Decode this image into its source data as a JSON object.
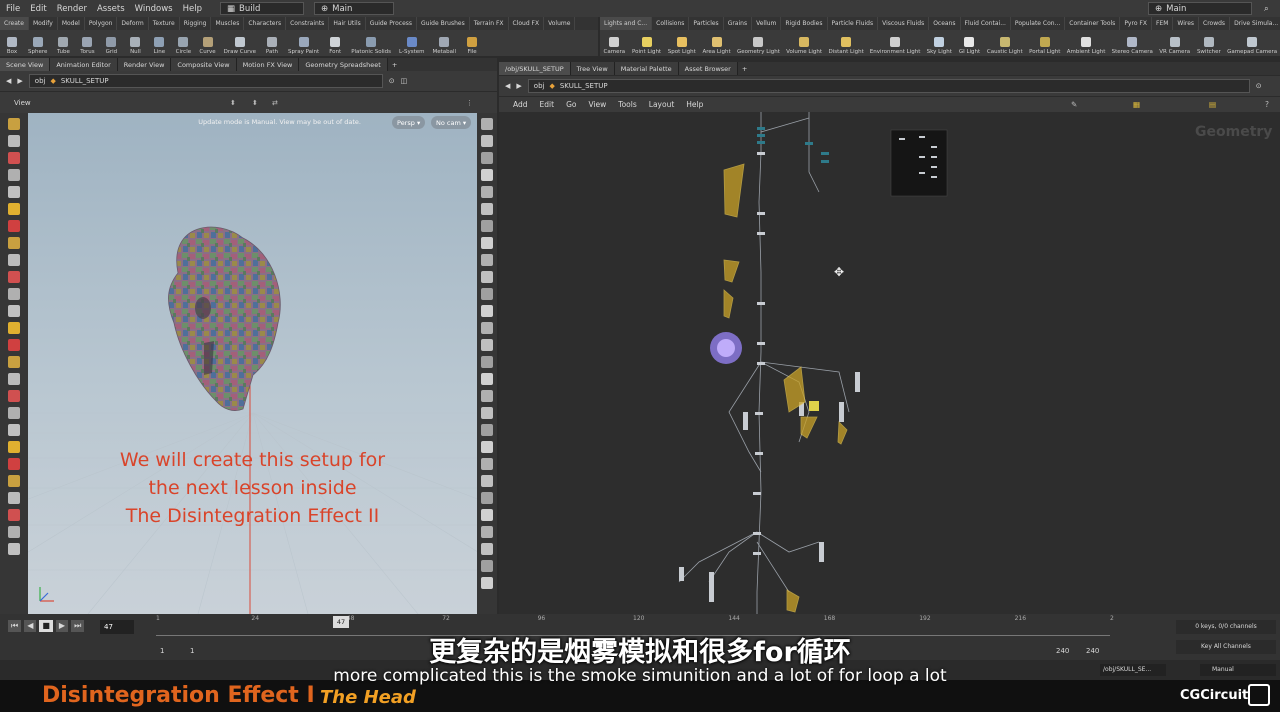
{
  "menu": [
    "File",
    "Edit",
    "Render",
    "Assets",
    "Windows",
    "Help"
  ],
  "desktop": "Build",
  "context": "Main",
  "context_right": "Main",
  "shelf_tabs_left": [
    "Create",
    "Modify",
    "Model",
    "Polygon",
    "Deform",
    "Texture",
    "Rigging",
    "Muscles",
    "Characters",
    "Constraints",
    "Hair Utils",
    "Guide Process",
    "Guide Brushes",
    "Terrain FX",
    "Cloud FX",
    "Volume"
  ],
  "shelf_tabs_right": [
    "Lights and C...",
    "Collisions",
    "Particles",
    "Grains",
    "Vellum",
    "Rigid Bodies",
    "Particle Fluids",
    "Viscous Fluids",
    "Oceans",
    "Fluid Contai...",
    "Populate Con...",
    "Container Tools",
    "Pyro FX",
    "FEM",
    "Wires",
    "Crowds",
    "Drive Simula..."
  ],
  "shelf_tools_left": [
    "Box",
    "Sphere",
    "Tube",
    "Torus",
    "Grid",
    "Null",
    "Line",
    "Circle",
    "Curve",
    "Draw Curve",
    "Path",
    "Spray Paint",
    "Font",
    "Platonic Solids",
    "L-System",
    "Metaball",
    "File"
  ],
  "shelf_tools_right": [
    "Camera",
    "Point Light",
    "Spot Light",
    "Area Light",
    "Geometry Light",
    "Volume Light",
    "Distant Light",
    "Environment Light",
    "Sky Light",
    "GI Light",
    "Caustic Light",
    "Portal Light",
    "Ambient Light",
    "Stereo Camera",
    "VR Camera",
    "Switcher",
    "Gamepad Camera"
  ],
  "left_pane_tabs": [
    "Scene View",
    "Animation Editor",
    "Render View",
    "Composite View",
    "Motion FX View",
    "Geometry Spreadsheet"
  ],
  "right_pane_tabs": [
    "/obj/SKULL_SETUP",
    "Tree View",
    "Material Palette",
    "Asset Browser"
  ],
  "left_path": {
    "root": "obj",
    "node": "SKULL_SETUP"
  },
  "right_path": {
    "root": "obj",
    "node": "SKULL_SETUP"
  },
  "view_label": "View",
  "viewport_notice": "Update mode is Manual. View may be out of date.",
  "persp_label": "Persp",
  "cam_label": "No cam",
  "overlay_text": [
    "We will create this setup for",
    "the next lesson inside",
    "The Disintegration Effect II"
  ],
  "network_menu": [
    "Add",
    "Edit",
    "Go",
    "View",
    "Tools",
    "Layout",
    "Help"
  ],
  "network_watermark": "Geometry",
  "timeline": {
    "current_frame": "47",
    "ticks": [
      "1",
      "24",
      "48",
      "72",
      "96",
      "120",
      "144",
      "168",
      "192",
      "216",
      "2"
    ],
    "start": "1",
    "start2": "1",
    "end": "240",
    "end2": "240",
    "keys_info": "0 keys, 0/0 channels",
    "key_all": "Key All Channels",
    "path": "/obj/SKULL_SE...",
    "update_mode": "Manual"
  },
  "captions": {
    "cn": "更复杂的是烟雾模拟和很多for循环",
    "en": "more complicated this is the smoke simunition and a lot of for loop a lot"
  },
  "branding": {
    "title": "Disintegration Effect I",
    "subtitle": "The Head",
    "logo": "CGCircuit",
    "title_color": "#e0651e",
    "subtitle_color": "#f2a024"
  },
  "colors": {
    "overlay_text": "#d9442a",
    "node_yellow": "#c9a227",
    "node_highlight": "#8c7ae0"
  }
}
